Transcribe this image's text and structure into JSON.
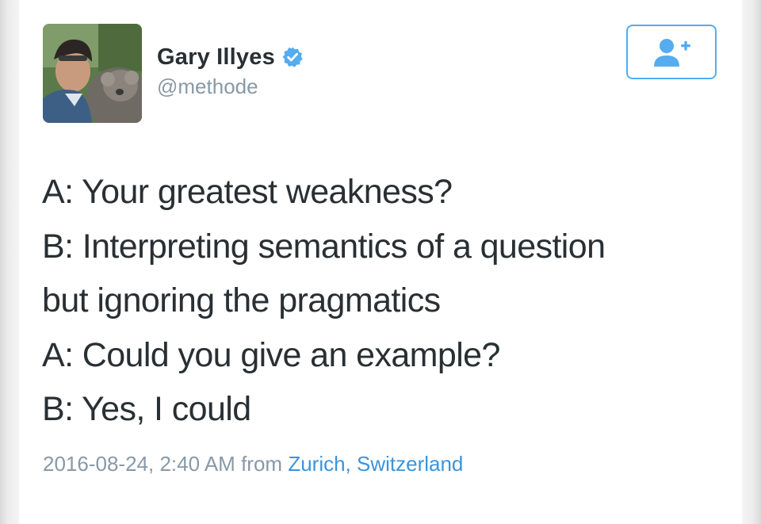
{
  "user": {
    "display_name": "Gary Illyes",
    "handle": "@methode",
    "avatar_icon": "profile-photo",
    "verified_icon": "verified-badge-icon"
  },
  "follow_button": {
    "icon": "follow-user-plus-icon",
    "accent_color": "#55acee"
  },
  "tweet": {
    "lines": [
      "A: Your greatest weakness?",
      "B: Interpreting semantics of a question",
      "but ignoring the pragmatics",
      "A: Could you give an example?",
      "B: Yes, I could"
    ]
  },
  "meta": {
    "timestamp": "2016-08-24, 2:40 AM",
    "from_label": "from",
    "location": "Zurich, Switzerland",
    "link_color": "#3b94d9"
  }
}
